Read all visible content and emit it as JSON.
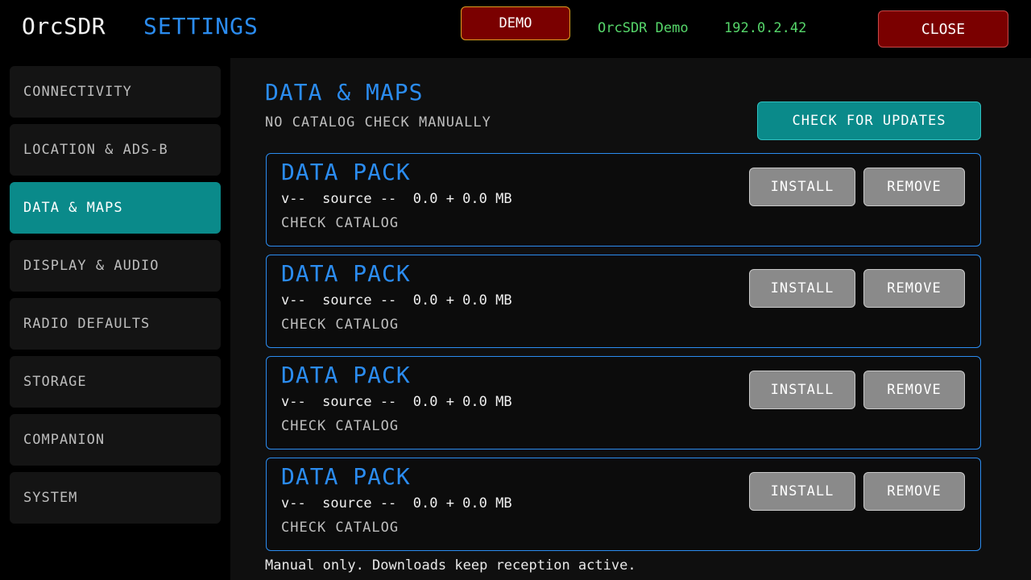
{
  "header": {
    "brand": "OrcSDR",
    "title": "SETTINGS",
    "demo_label": "DEMO",
    "device_name": "OrcSDR Demo",
    "device_ip": "192.0.2.42",
    "close_label": "CLOSE"
  },
  "sidebar": {
    "items": [
      {
        "label": "CONNECTIVITY"
      },
      {
        "label": "LOCATION & ADS-B"
      },
      {
        "label": "DATA & MAPS"
      },
      {
        "label": "DISPLAY & AUDIO"
      },
      {
        "label": "RADIO DEFAULTS"
      },
      {
        "label": "STORAGE"
      },
      {
        "label": "COMPANION"
      },
      {
        "label": "SYSTEM"
      }
    ],
    "active_index": 2
  },
  "main": {
    "title": "DATA & MAPS",
    "subtitle": "NO CATALOG CHECK MANUALLY",
    "update_label": "CHECK FOR UPDATES",
    "packs": [
      {
        "title": "DATA PACK",
        "meta": "v--  source --  0.0 + 0.0 MB",
        "status": "CHECK CATALOG",
        "install_label": "INSTALL",
        "remove_label": "REMOVE"
      },
      {
        "title": "DATA PACK",
        "meta": "v--  source --  0.0 + 0.0 MB",
        "status": "CHECK CATALOG",
        "install_label": "INSTALL",
        "remove_label": "REMOVE"
      },
      {
        "title": "DATA PACK",
        "meta": "v--  source --  0.0 + 0.0 MB",
        "status": "CHECK CATALOG",
        "install_label": "INSTALL",
        "remove_label": "REMOVE"
      },
      {
        "title": "DATA PACK",
        "meta": "v--  source --  0.0 + 0.0 MB",
        "status": "CHECK CATALOG",
        "install_label": "INSTALL",
        "remove_label": "REMOVE"
      }
    ],
    "footer_note": "Manual only. Downloads keep reception active."
  },
  "colors": {
    "accent_blue": "#2b8cf0",
    "teal": "#0a8a8a",
    "danger_red": "#7a0000",
    "status_green": "#56d66a"
  }
}
